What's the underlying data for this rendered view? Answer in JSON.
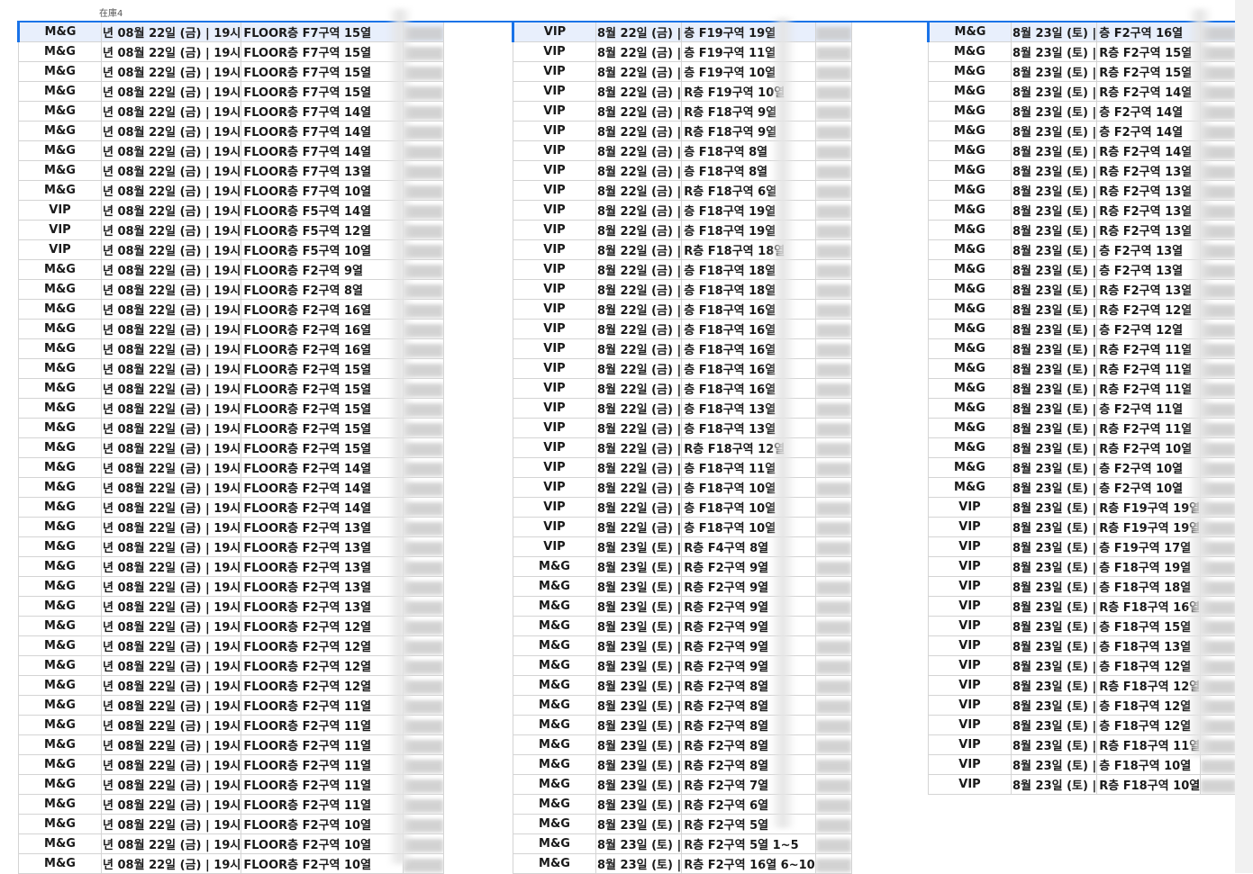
{
  "sheet": {
    "header_label": "在庫4",
    "blocks": [
      {
        "selected_row": 0,
        "rows": [
          {
            "type": "M&G",
            "date": "년 08월 22일 (금) | 19시",
            "seat": "FLOOR층 F7구역 15열"
          },
          {
            "type": "M&G",
            "date": "년 08월 22일 (금) | 19시",
            "seat": "FLOOR층 F7구역 15열"
          },
          {
            "type": "M&G",
            "date": "년 08월 22일 (금) | 19시",
            "seat": "FLOOR층 F7구역 15열"
          },
          {
            "type": "M&G",
            "date": "년 08월 22일 (금) | 19시",
            "seat": "FLOOR층 F7구역 15열"
          },
          {
            "type": "M&G",
            "date": "년 08월 22일 (금) | 19시",
            "seat": "FLOOR층 F7구역 14열"
          },
          {
            "type": "M&G",
            "date": "년 08월 22일 (금) | 19시",
            "seat": "FLOOR층 F7구역 14열"
          },
          {
            "type": "M&G",
            "date": "년 08월 22일 (금) | 19시",
            "seat": "FLOOR층 F7구역 14열"
          },
          {
            "type": "M&G",
            "date": "년 08월 22일 (금) | 19시",
            "seat": "FLOOR층 F7구역 13열"
          },
          {
            "type": "M&G",
            "date": "년 08월 22일 (금) | 19시",
            "seat": "FLOOR층 F7구역 10열"
          },
          {
            "type": "VIP",
            "date": "년 08월 22일 (금) | 19시",
            "seat": "FLOOR층 F5구역 14열"
          },
          {
            "type": "VIP",
            "date": "년 08월 22일 (금) | 19시",
            "seat": "FLOOR층 F5구역 12열"
          },
          {
            "type": "VIP",
            "date": "년 08월 22일 (금) | 19시",
            "seat": "FLOOR층 F5구역 10열"
          },
          {
            "type": "M&G",
            "date": "년 08월 22일 (금) | 19시",
            "seat": "FLOOR층 F2구역 9열"
          },
          {
            "type": "M&G",
            "date": "년 08월 22일 (금) | 19시",
            "seat": "FLOOR층 F2구역 8열"
          },
          {
            "type": "M&G",
            "date": "년 08월 22일 (금) | 19시",
            "seat": "FLOOR층 F2구역 16열"
          },
          {
            "type": "M&G",
            "date": "년 08월 22일 (금) | 19시",
            "seat": "FLOOR층 F2구역 16열"
          },
          {
            "type": "M&G",
            "date": "년 08월 22일 (금) | 19시",
            "seat": "FLOOR층 F2구역 16열"
          },
          {
            "type": "M&G",
            "date": "년 08월 22일 (금) | 19시",
            "seat": "FLOOR층 F2구역 15열"
          },
          {
            "type": "M&G",
            "date": "년 08월 22일 (금) | 19시",
            "seat": "FLOOR층 F2구역 15열"
          },
          {
            "type": "M&G",
            "date": "년 08월 22일 (금) | 19시",
            "seat": "FLOOR층 F2구역 15열"
          },
          {
            "type": "M&G",
            "date": "년 08월 22일 (금) | 19시",
            "seat": "FLOOR층 F2구역 15열"
          },
          {
            "type": "M&G",
            "date": "년 08월 22일 (금) | 19시",
            "seat": "FLOOR층 F2구역 15열"
          },
          {
            "type": "M&G",
            "date": "년 08월 22일 (금) | 19시",
            "seat": "FLOOR층 F2구역 14열"
          },
          {
            "type": "M&G",
            "date": "년 08월 22일 (금) | 19시",
            "seat": "FLOOR층 F2구역 14열"
          },
          {
            "type": "M&G",
            "date": "년 08월 22일 (금) | 19시",
            "seat": "FLOOR층 F2구역 14열"
          },
          {
            "type": "M&G",
            "date": "년 08월 22일 (금) | 19시",
            "seat": "FLOOR층 F2구역 13열"
          },
          {
            "type": "M&G",
            "date": "년 08월 22일 (금) | 19시",
            "seat": "FLOOR층 F2구역 13열"
          },
          {
            "type": "M&G",
            "date": "년 08월 22일 (금) | 19시",
            "seat": "FLOOR층 F2구역 13열"
          },
          {
            "type": "M&G",
            "date": "년 08월 22일 (금) | 19시",
            "seat": "FLOOR층 F2구역 13열"
          },
          {
            "type": "M&G",
            "date": "년 08월 22일 (금) | 19시",
            "seat": "FLOOR층 F2구역 13열"
          },
          {
            "type": "M&G",
            "date": "년 08월 22일 (금) | 19시",
            "seat": "FLOOR층 F2구역 12열"
          },
          {
            "type": "M&G",
            "date": "년 08월 22일 (금) | 19시",
            "seat": "FLOOR층 F2구역 12열"
          },
          {
            "type": "M&G",
            "date": "년 08월 22일 (금) | 19시",
            "seat": "FLOOR층 F2구역 12열"
          },
          {
            "type": "M&G",
            "date": "년 08월 22일 (금) | 19시",
            "seat": "FLOOR층 F2구역 12열"
          },
          {
            "type": "M&G",
            "date": "년 08월 22일 (금) | 19시",
            "seat": "FLOOR층 F2구역 11열"
          },
          {
            "type": "M&G",
            "date": "년 08월 22일 (금) | 19시",
            "seat": "FLOOR층 F2구역 11열"
          },
          {
            "type": "M&G",
            "date": "년 08월 22일 (금) | 19시",
            "seat": "FLOOR층 F2구역 11열"
          },
          {
            "type": "M&G",
            "date": "년 08월 22일 (금) | 19시",
            "seat": "FLOOR층 F2구역 11열"
          },
          {
            "type": "M&G",
            "date": "년 08월 22일 (금) | 19시",
            "seat": "FLOOR층 F2구역 11열"
          },
          {
            "type": "M&G",
            "date": "년 08월 22일 (금) | 19시",
            "seat": "FLOOR층 F2구역 11열"
          },
          {
            "type": "M&G",
            "date": "년 08월 22일 (금) | 19시",
            "seat": "FLOOR층 F2구역 10열"
          },
          {
            "type": "M&G",
            "date": "년 08월 22일 (금) | 19시",
            "seat": "FLOOR층 F2구역 10열"
          },
          {
            "type": "M&G",
            "date": "년 08월 22일 (금) | 19시",
            "seat": "FLOOR층 F2구역 10열"
          }
        ]
      },
      {
        "selected_row": 0,
        "rows": [
          {
            "type": "VIP",
            "date": "8월 22일 (금) |",
            "seat": "층 F19구역 19열"
          },
          {
            "type": "VIP",
            "date": "8월 22일 (금) |",
            "seat": "층 F19구역 11열"
          },
          {
            "type": "VIP",
            "date": "8월 22일 (금) |",
            "seat": "층 F19구역 10열"
          },
          {
            "type": "VIP",
            "date": "8월 22일 (금) |",
            "seat": "R층 F19구역 10열"
          },
          {
            "type": "VIP",
            "date": "8월 22일 (금) |",
            "seat": "R층 F18구역 9열"
          },
          {
            "type": "VIP",
            "date": "8월 22일 (금) |",
            "seat": "R층 F18구역 9열"
          },
          {
            "type": "VIP",
            "date": "8월 22일 (금) |",
            "seat": "층 F18구역 8열"
          },
          {
            "type": "VIP",
            "date": "8월 22일 (금) |",
            "seat": "층 F18구역 8열"
          },
          {
            "type": "VIP",
            "date": "8월 22일 (금) |",
            "seat": "R층 F18구역 6열"
          },
          {
            "type": "VIP",
            "date": "8월 22일 (금) |",
            "seat": "층 F18구역 19열"
          },
          {
            "type": "VIP",
            "date": "8월 22일 (금) |",
            "seat": "층 F18구역 19열"
          },
          {
            "type": "VIP",
            "date": "8월 22일 (금) |",
            "seat": "R층 F18구역 18열"
          },
          {
            "type": "VIP",
            "date": "8월 22일 (금) |",
            "seat": "층 F18구역 18열"
          },
          {
            "type": "VIP",
            "date": "8월 22일 (금) |",
            "seat": "층 F18구역 18열"
          },
          {
            "type": "VIP",
            "date": "8월 22일 (금) |",
            "seat": "층 F18구역 16열"
          },
          {
            "type": "VIP",
            "date": "8월 22일 (금) |",
            "seat": "층 F18구역 16열"
          },
          {
            "type": "VIP",
            "date": "8월 22일 (금) |",
            "seat": "층 F18구역 16열"
          },
          {
            "type": "VIP",
            "date": "8월 22일 (금) |",
            "seat": "층 F18구역 16열"
          },
          {
            "type": "VIP",
            "date": "8월 22일 (금) |",
            "seat": "층 F18구역 16열"
          },
          {
            "type": "VIP",
            "date": "8월 22일 (금) |",
            "seat": "층 F18구역 13열"
          },
          {
            "type": "VIP",
            "date": "8월 22일 (금) |",
            "seat": "층 F18구역 13열"
          },
          {
            "type": "VIP",
            "date": "8월 22일 (금) |",
            "seat": "R층 F18구역 12열"
          },
          {
            "type": "VIP",
            "date": "8월 22일 (금) |",
            "seat": "층 F18구역 11열"
          },
          {
            "type": "VIP",
            "date": "8월 22일 (금) |",
            "seat": "층 F18구역 10열"
          },
          {
            "type": "VIP",
            "date": "8월 22일 (금) |",
            "seat": "층 F18구역 10열"
          },
          {
            "type": "VIP",
            "date": "8월 22일 (금) |",
            "seat": "층 F18구역 10열"
          },
          {
            "type": "VIP",
            "date": "8월 23일 (토) |",
            "seat": "R층 F4구역 8열"
          },
          {
            "type": "M&G",
            "date": "8월 23일 (토) |",
            "seat": "R층 F2구역 9열"
          },
          {
            "type": "M&G",
            "date": "8월 23일 (토) |",
            "seat": "R층 F2구역 9열"
          },
          {
            "type": "M&G",
            "date": "8월 23일 (토) |",
            "seat": "R층 F2구역 9열"
          },
          {
            "type": "M&G",
            "date": "8월 23일 (토) |",
            "seat": "R층 F2구역 9열"
          },
          {
            "type": "M&G",
            "date": "8월 23일 (토) |",
            "seat": "R층 F2구역 9열"
          },
          {
            "type": "M&G",
            "date": "8월 23일 (토) |",
            "seat": "R층 F2구역 9열"
          },
          {
            "type": "M&G",
            "date": "8월 23일 (토) |",
            "seat": "R층 F2구역 8열"
          },
          {
            "type": "M&G",
            "date": "8월 23일 (토) |",
            "seat": "R층 F2구역 8열"
          },
          {
            "type": "M&G",
            "date": "8월 23일 (토) |",
            "seat": "R층 F2구역 8열"
          },
          {
            "type": "M&G",
            "date": "8월 23일 (토) |",
            "seat": "R층 F2구역 8열"
          },
          {
            "type": "M&G",
            "date": "8월 23일 (토) |",
            "seat": "R층 F2구역 8열"
          },
          {
            "type": "M&G",
            "date": "8월 23일 (토) |",
            "seat": "R층 F2구역 7열"
          },
          {
            "type": "M&G",
            "date": "8월 23일 (토) |",
            "seat": "R층 F2구역 6열"
          },
          {
            "type": "M&G",
            "date": "8월 23일 (토) |",
            "seat": "R층 F2구역 5열"
          },
          {
            "type": "M&G",
            "date": "8월 23일 (토) |",
            "seat": "R층 F2구역 5열 1~5"
          },
          {
            "type": "M&G",
            "date": "8월 23일 (토) |",
            "seat": "R층 F2구역 16열 6~10"
          }
        ]
      },
      {
        "selected_row": 0,
        "rows": [
          {
            "type": "M&G",
            "date": "8월 23일 (토) |",
            "seat": "층 F2구역 16열"
          },
          {
            "type": "M&G",
            "date": "8월 23일 (토) |",
            "seat": "R층 F2구역 15열"
          },
          {
            "type": "M&G",
            "date": "8월 23일 (토) |",
            "seat": "R층 F2구역 15열"
          },
          {
            "type": "M&G",
            "date": "8월 23일 (토) |",
            "seat": "R층 F2구역 14열"
          },
          {
            "type": "M&G",
            "date": "8월 23일 (토) |",
            "seat": "층 F2구역 14열"
          },
          {
            "type": "M&G",
            "date": "8월 23일 (토) |",
            "seat": "층 F2구역 14열"
          },
          {
            "type": "M&G",
            "date": "8월 23일 (토) |",
            "seat": "R층 F2구역 14열"
          },
          {
            "type": "M&G",
            "date": "8월 23일 (토) |",
            "seat": "R층 F2구역 13열"
          },
          {
            "type": "M&G",
            "date": "8월 23일 (토) |",
            "seat": "R층 F2구역 13열"
          },
          {
            "type": "M&G",
            "date": "8월 23일 (토) |",
            "seat": "R층 F2구역 13열"
          },
          {
            "type": "M&G",
            "date": "8월 23일 (토) |",
            "seat": "R층 F2구역 13열"
          },
          {
            "type": "M&G",
            "date": "8월 23일 (토) |",
            "seat": "층 F2구역 13열"
          },
          {
            "type": "M&G",
            "date": "8월 23일 (토) |",
            "seat": "층 F2구역 13열"
          },
          {
            "type": "M&G",
            "date": "8월 23일 (토) |",
            "seat": "R층 F2구역 13열"
          },
          {
            "type": "M&G",
            "date": "8월 23일 (토) |",
            "seat": "R층 F2구역 12열"
          },
          {
            "type": "M&G",
            "date": "8월 23일 (토) |",
            "seat": "층 F2구역 12열"
          },
          {
            "type": "M&G",
            "date": "8월 23일 (토) |",
            "seat": "R층 F2구역 11열"
          },
          {
            "type": "M&G",
            "date": "8월 23일 (토) |",
            "seat": "R층 F2구역 11열"
          },
          {
            "type": "M&G",
            "date": "8월 23일 (토) |",
            "seat": "R층 F2구역 11열"
          },
          {
            "type": "M&G",
            "date": "8월 23일 (토) |",
            "seat": "층 F2구역 11열"
          },
          {
            "type": "M&G",
            "date": "8월 23일 (토) |",
            "seat": "R층 F2구역 11열"
          },
          {
            "type": "M&G",
            "date": "8월 23일 (토) |",
            "seat": "R층 F2구역 10열"
          },
          {
            "type": "M&G",
            "date": "8월 23일 (토) |",
            "seat": "층 F2구역 10열"
          },
          {
            "type": "M&G",
            "date": "8월 23일 (토) |",
            "seat": "층 F2구역 10열"
          },
          {
            "type": "VIP",
            "date": "8월 23일 (토) |",
            "seat": "R층 F19구역 19열"
          },
          {
            "type": "VIP",
            "date": "8월 23일 (토) |",
            "seat": "R층 F19구역 19열"
          },
          {
            "type": "VIP",
            "date": "8월 23일 (토) |",
            "seat": "층 F19구역 17열"
          },
          {
            "type": "VIP",
            "date": "8월 23일 (토) |",
            "seat": "층 F18구역 19열"
          },
          {
            "type": "VIP",
            "date": "8월 23일 (토) |",
            "seat": "층 F18구역 18열"
          },
          {
            "type": "VIP",
            "date": "8월 23일 (토) |",
            "seat": "R층 F18구역 16열"
          },
          {
            "type": "VIP",
            "date": "8월 23일 (토) |",
            "seat": "층 F18구역 15열"
          },
          {
            "type": "VIP",
            "date": "8월 23일 (토) |",
            "seat": "층 F18구역 13열"
          },
          {
            "type": "VIP",
            "date": "8월 23일 (토) |",
            "seat": "층 F18구역 12열"
          },
          {
            "type": "VIP",
            "date": "8월 23일 (토) |",
            "seat": "R층 F18구역 12열"
          },
          {
            "type": "VIP",
            "date": "8월 23일 (토) |",
            "seat": "층 F18구역 12열"
          },
          {
            "type": "VIP",
            "date": "8월 23일 (토) |",
            "seat": "층 F18구역 12열"
          },
          {
            "type": "VIP",
            "date": "8월 23일 (토) |",
            "seat": "R층 F18구역 11열"
          },
          {
            "type": "VIP",
            "date": "8월 23일 (토) |",
            "seat": "층 F18구역 10열"
          },
          {
            "type": "VIP",
            "date": "8월 23일 (토) |",
            "seat": "R층 F18구역 10열"
          }
        ]
      }
    ]
  }
}
